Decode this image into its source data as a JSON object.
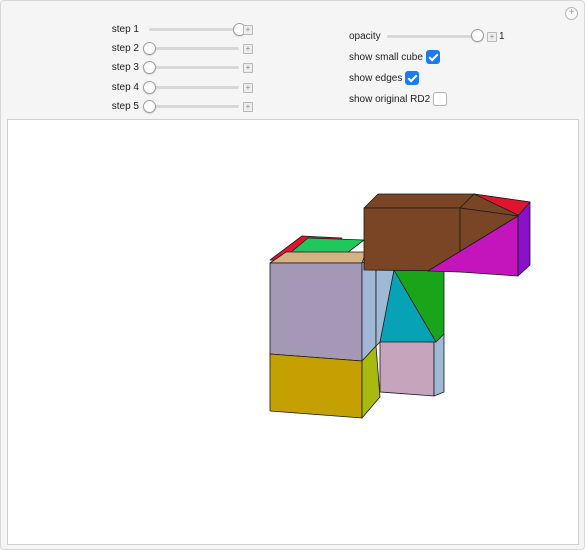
{
  "controls": {
    "steps": [
      {
        "label": "step 1",
        "value": 1
      },
      {
        "label": "step 2",
        "value": 0
      },
      {
        "label": "step 3",
        "value": 0
      },
      {
        "label": "step 4",
        "value": 0
      },
      {
        "label": "step 5",
        "value": 0
      }
    ],
    "opacity": {
      "label": "opacity",
      "value": 1,
      "value_text": "1"
    },
    "show_small_cube": {
      "label": "show small cube",
      "checked": true
    },
    "show_edges": {
      "label": "show edges",
      "checked": true
    },
    "show_original": {
      "label": "show original RD2",
      "checked": false
    }
  },
  "icons": {
    "corner": "plus-circle-icon",
    "slider_increment": "plus-square-icon"
  },
  "colors": {
    "checkbox_accent": "#1a7cf5",
    "panel_bg": "#f5f5f5",
    "viewport_bg": "#ffffff",
    "faces": {
      "lavender": "#a597b6",
      "light_blue": "#9fb9d4",
      "yellow_front": "#c4a000",
      "olive": "#a8ba10",
      "pink": "#c5a4bc",
      "brown": "#7a4525",
      "magenta": "#c415bd",
      "purple": "#8a10c9",
      "teal": "#07a2b5",
      "green": "#1aa41a",
      "red": "#e0142e",
      "tan": "#d6b183",
      "green_light": "#1ec85a"
    }
  }
}
